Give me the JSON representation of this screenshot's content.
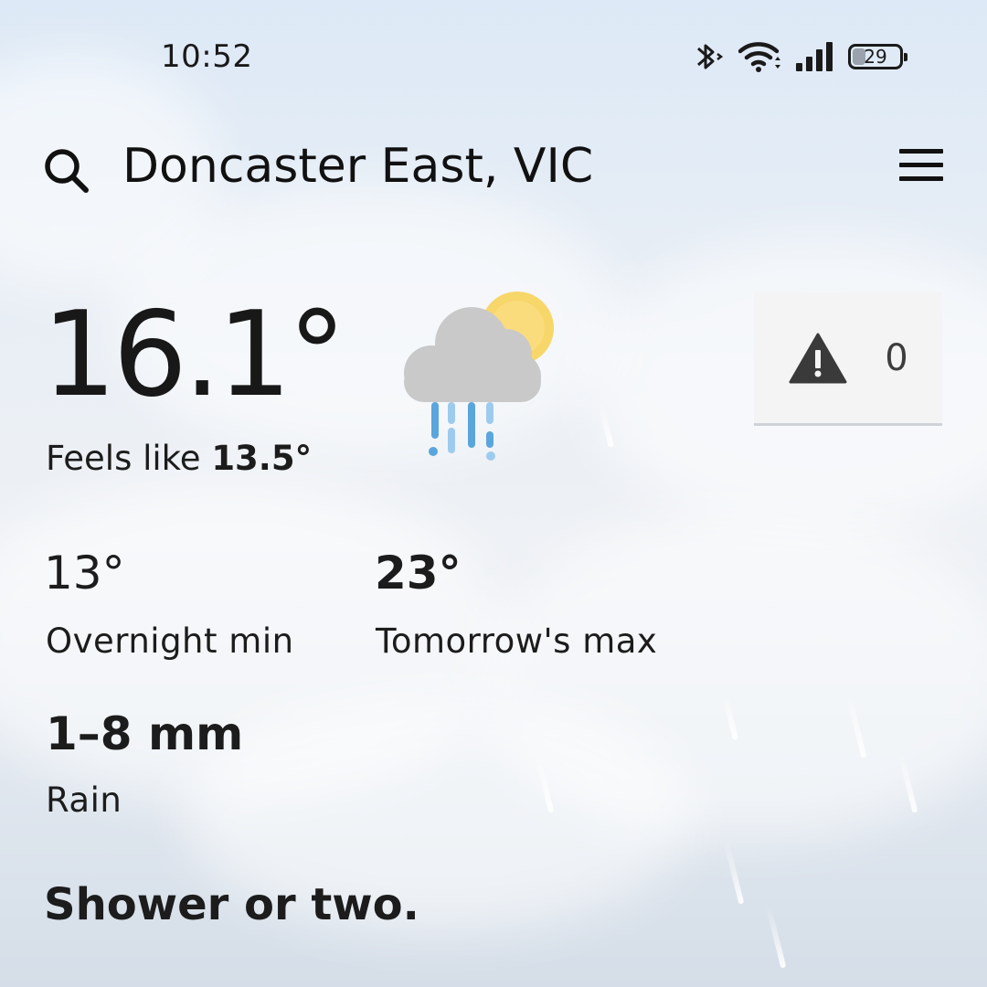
{
  "status_bar": {
    "time": "10:52",
    "battery_level": "29",
    "icons": [
      "bluetooth-icon",
      "wifi-icon",
      "signal-icon",
      "battery-icon"
    ]
  },
  "header": {
    "location": "Doncaster East, VIC",
    "search_icon": "search-icon",
    "menu_icon": "menu-icon"
  },
  "current": {
    "temperature": "16.1°",
    "feels_like_label": "Feels like",
    "feels_like_value": "13.5°",
    "condition_icon": "showers-partly-sunny-icon"
  },
  "warnings": {
    "icon": "warning-icon",
    "count": "0"
  },
  "forecast": {
    "overnight_min_value": "13°",
    "overnight_min_label": "Overnight min",
    "tomorrow_max_value": "23°",
    "tomorrow_max_label": "Tomorrow's max",
    "rain_value": "1–8 mm",
    "rain_label": "Rain",
    "summary": "Shower or two."
  },
  "colors": {
    "sun": "#f7d66a",
    "cloud": "#c9c9c9",
    "rain_dark": "#5aa6dc",
    "rain_light": "#9dcbee",
    "warning_icon": "#3a3a3a"
  }
}
